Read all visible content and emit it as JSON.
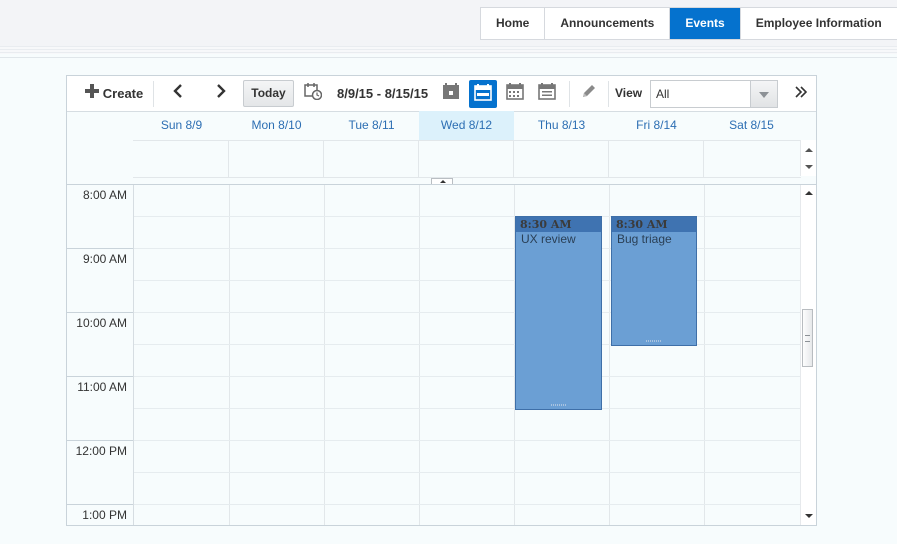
{
  "nav": {
    "items": [
      {
        "label": "Home",
        "active": false
      },
      {
        "label": "Announcements",
        "active": false
      },
      {
        "label": "Events",
        "active": true
      },
      {
        "label": "Employee Information",
        "active": false
      }
    ]
  },
  "toolbar": {
    "create_label": "Create",
    "today_label": "Today",
    "date_range": "8/9/15 - 8/15/15",
    "view_label": "View",
    "view_value": "All",
    "active_view": "week"
  },
  "days": [
    "Sun 8/9",
    "Mon 8/10",
    "Tue 8/11",
    "Wed 8/12",
    "Thu 8/13",
    "Fri 8/14",
    "Sat 8/15"
  ],
  "today_index": 3,
  "hours": [
    "8:00 AM",
    "9:00 AM",
    "10:00 AM",
    "11:00 AM",
    "12:00 PM",
    "1:00 PM"
  ],
  "events": [
    {
      "time": "8:30 AM",
      "title": "UX review",
      "day_index": 4
    },
    {
      "time": "8:30 AM",
      "title": "Bug triage",
      "day_index": 5
    }
  ],
  "colors": {
    "accent": "#0572ce",
    "event_fill": "#6b9fd4",
    "event_header": "#3f73b1",
    "today_header": "#dcf1fb"
  }
}
